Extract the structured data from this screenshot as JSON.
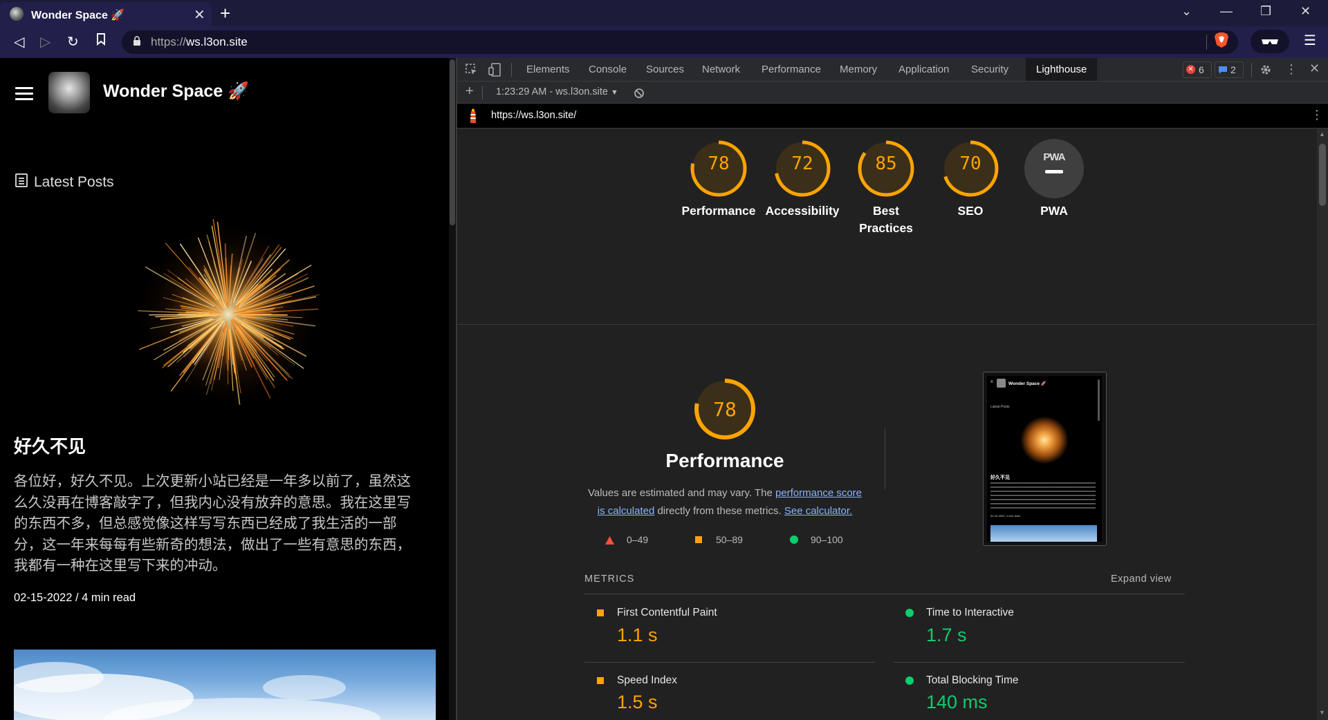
{
  "browser": {
    "tab_title": "Wonder Space 🚀",
    "url_scheme": "https://",
    "url_host": "ws.l3on.site"
  },
  "page": {
    "site_title": "Wonder Space 🚀",
    "latest_label": "Latest Posts",
    "post": {
      "title": "好久不见",
      "excerpt_lines": [
        "各位好，好久不见。上次更新小站已经是一年多以前了，虽然这",
        "么久没再在博客敲字了，但我内心没有放弃的意思。我在这里写",
        "的东西不多，但总感觉像这样写写东西已经成了我生活的一部",
        "分，这一年来每每有些新奇的想法，做出了一些有意思的东西，",
        "我都有一种在这里写下来的冲动。"
      ],
      "meta": "02-15-2022 / 4 min read"
    }
  },
  "devtools": {
    "tabs": [
      "Elements",
      "Console",
      "Sources",
      "Network",
      "Performance",
      "Memory",
      "Application",
      "Security",
      "Lighthouse"
    ],
    "active_tab": "Lighthouse",
    "error_count": "6",
    "message_count": "2",
    "report_select": "1:23:29 AM - ws.l3on.site",
    "report_url": "https://ws.l3on.site/"
  },
  "lighthouse": {
    "scores": [
      {
        "label": "Performance",
        "value": 78
      },
      {
        "label": "Accessibility",
        "value": 72
      },
      {
        "label": "Best Practices",
        "value": 85
      },
      {
        "label": "SEO",
        "value": 70
      },
      {
        "label": "PWA",
        "value": null
      }
    ],
    "pwa_badge": "PWA",
    "perf": {
      "score": "78",
      "title": "Performance",
      "desc_pre": "Values are estimated and may vary. The ",
      "desc_link1_a": "performance score",
      "desc_link1_b": "is calculated",
      "desc_mid": " directly from these metrics. ",
      "desc_link2": "See calculator.",
      "legend": [
        "0–49",
        "50–89",
        "90–100"
      ]
    },
    "metrics_header": "METRICS",
    "expand_view": "Expand view",
    "metrics": [
      {
        "name": "First Contentful Paint",
        "value": "1.1 s",
        "status": "average"
      },
      {
        "name": "Time to Interactive",
        "value": "1.7 s",
        "status": "pass"
      },
      {
        "name": "Speed Index",
        "value": "1.5 s",
        "status": "average"
      },
      {
        "name": "Total Blocking Time",
        "value": "140 ms",
        "status": "pass"
      }
    ],
    "thumb": {
      "site_title": "Wonder Space 🚀",
      "latest": "Latest Posts",
      "post_title": "好久不见",
      "meta": "02-15-2022 / 4 min read"
    },
    "colors": {
      "average": "#ffa400",
      "pass": "#0cce6b",
      "fail": "#ff4e42"
    }
  }
}
